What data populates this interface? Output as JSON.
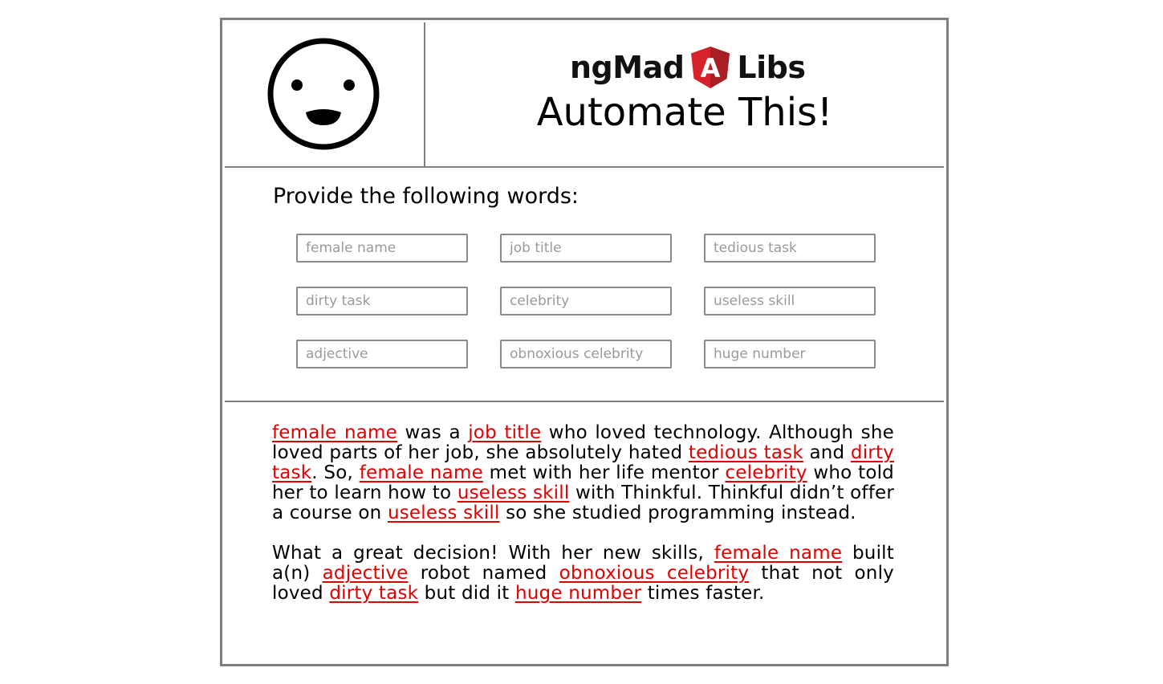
{
  "header": {
    "logo_left": "ngMad",
    "logo_right": "Libs",
    "logo_badge_letter": "A",
    "title": "Automate This!"
  },
  "colors": {
    "border": "#7f7f7f",
    "blank_text": "#e10000",
    "badge_red": "#d6222b",
    "badge_dark": "#a71e24"
  },
  "icons": {
    "smiley": "smiley-face-icon",
    "badge": "angular-shield-icon"
  },
  "form": {
    "prompt": "Provide the following words:",
    "fields": [
      {
        "key": "female_name",
        "placeholder": "female name",
        "value": ""
      },
      {
        "key": "job_title",
        "placeholder": "job title",
        "value": ""
      },
      {
        "key": "tedious_task",
        "placeholder": "tedious task",
        "value": ""
      },
      {
        "key": "dirty_task",
        "placeholder": "dirty task",
        "value": ""
      },
      {
        "key": "celebrity",
        "placeholder": "celebrity",
        "value": ""
      },
      {
        "key": "useless_skill",
        "placeholder": "useless skill",
        "value": ""
      },
      {
        "key": "adjective",
        "placeholder": "adjective",
        "value": ""
      },
      {
        "key": "obnoxious_celebrity",
        "placeholder": "obnoxious celebrity",
        "value": ""
      },
      {
        "key": "huge_number",
        "placeholder": "huge number",
        "value": ""
      }
    ]
  },
  "story": {
    "p1": {
      "s1": "female name",
      "t1": " was a ",
      "s2": "job title",
      "t2": " who loved technology. Although she loved parts of her job, she absolutely hated ",
      "s3": "tedious task",
      "t3": " and ",
      "s4": "dirty task",
      "t4": ". So, ",
      "s5": "female name",
      "t5": " met with her life mentor ",
      "s6": "celebrity",
      "t6": " who told her to learn how to ",
      "s7": "useless skill",
      "t7": " with Thinkful. Thinkful didn’t offer a course on ",
      "s8": "useless skill",
      "t8": " so she studied programming instead."
    },
    "p2": {
      "t1": "What a great decision! With her new skills, ",
      "s1": "female name",
      "t2": " built a(n) ",
      "s2": "adjective",
      "t3": " robot named ",
      "s3": "obnoxious celebrity",
      "t4": " that not only loved ",
      "s4": "dirty task",
      "t5": " but did it ",
      "s5": "huge number",
      "t6": " times faster."
    }
  }
}
